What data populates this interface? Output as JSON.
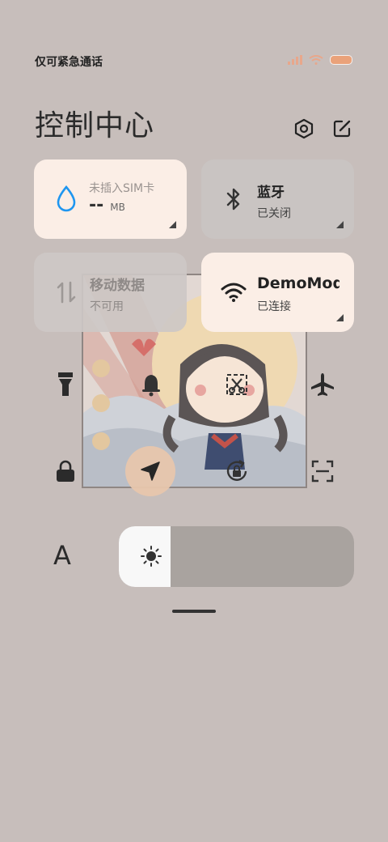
{
  "status_bar": {
    "carrier_text": "仅可紧急通话"
  },
  "header": {
    "title": "控制中心",
    "settings_icon": "hexagon-settings-icon",
    "edit_icon": "edit-icon"
  },
  "tiles": {
    "data_usage": {
      "label": "未插入SIM卡",
      "value": "--",
      "unit": "MB",
      "icon": "water-drop-icon"
    },
    "bluetooth": {
      "title": "蓝牙",
      "status": "已关闭",
      "icon": "bluetooth-icon"
    },
    "mobile_data": {
      "title": "移动数据",
      "status": "不可用",
      "icon": "mobile-data-icon"
    },
    "wifi": {
      "title": "DemoMod",
      "status": "已连接",
      "icon": "wifi-icon"
    }
  },
  "toggles": [
    "flashlight-icon",
    "bell-icon",
    "screenshot-icon",
    "airplane-icon",
    "lock-icon",
    "location-icon",
    "rotation-lock-icon",
    "scan-icon"
  ],
  "brightness": {
    "level": 0.22,
    "icon": "sun-icon"
  },
  "text_size_label": "A",
  "colors": {
    "accent": "#fbeee6",
    "drop_blue": "#1e96f0",
    "battery": "#eaa27a",
    "background": "#c7bebb"
  }
}
